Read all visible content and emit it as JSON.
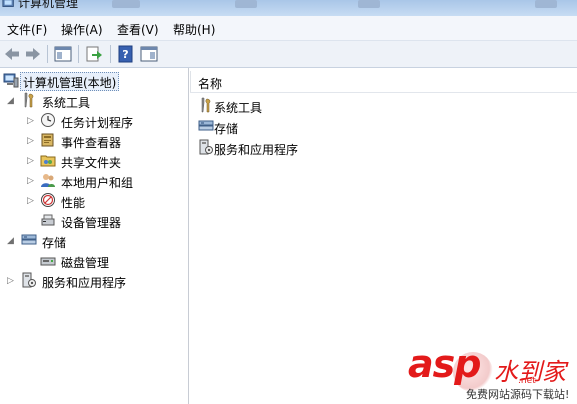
{
  "window": {
    "title": "计算机管理"
  },
  "menu": [
    "文件(F)",
    "操作(A)",
    "查看(V)",
    "帮助(H)"
  ],
  "toolbar": {
    "buttons": [
      "back-icon",
      "forward-icon",
      "show-hide-console-tree-icon",
      "export-list-icon",
      "help-icon",
      "show-hide-action-pane-icon"
    ]
  },
  "tree": {
    "root": "计算机管理(本地)",
    "system_tools": {
      "label": "系统工具",
      "children": [
        "任务计划程序",
        "事件查看器",
        "共享文件夹",
        "本地用户和组",
        "性能",
        "设备管理器"
      ]
    },
    "storage": {
      "label": "存储",
      "children": [
        "磁盘管理"
      ]
    },
    "services": {
      "label": "服务和应用程序"
    }
  },
  "list": {
    "column_header": "名称",
    "items": [
      "系统工具",
      "存储",
      "服务和应用程序"
    ]
  },
  "watermark": {
    "brand": "asp",
    "brand2": "水到家",
    "net": ".net",
    "sub": "免费网站源码下载站!"
  }
}
